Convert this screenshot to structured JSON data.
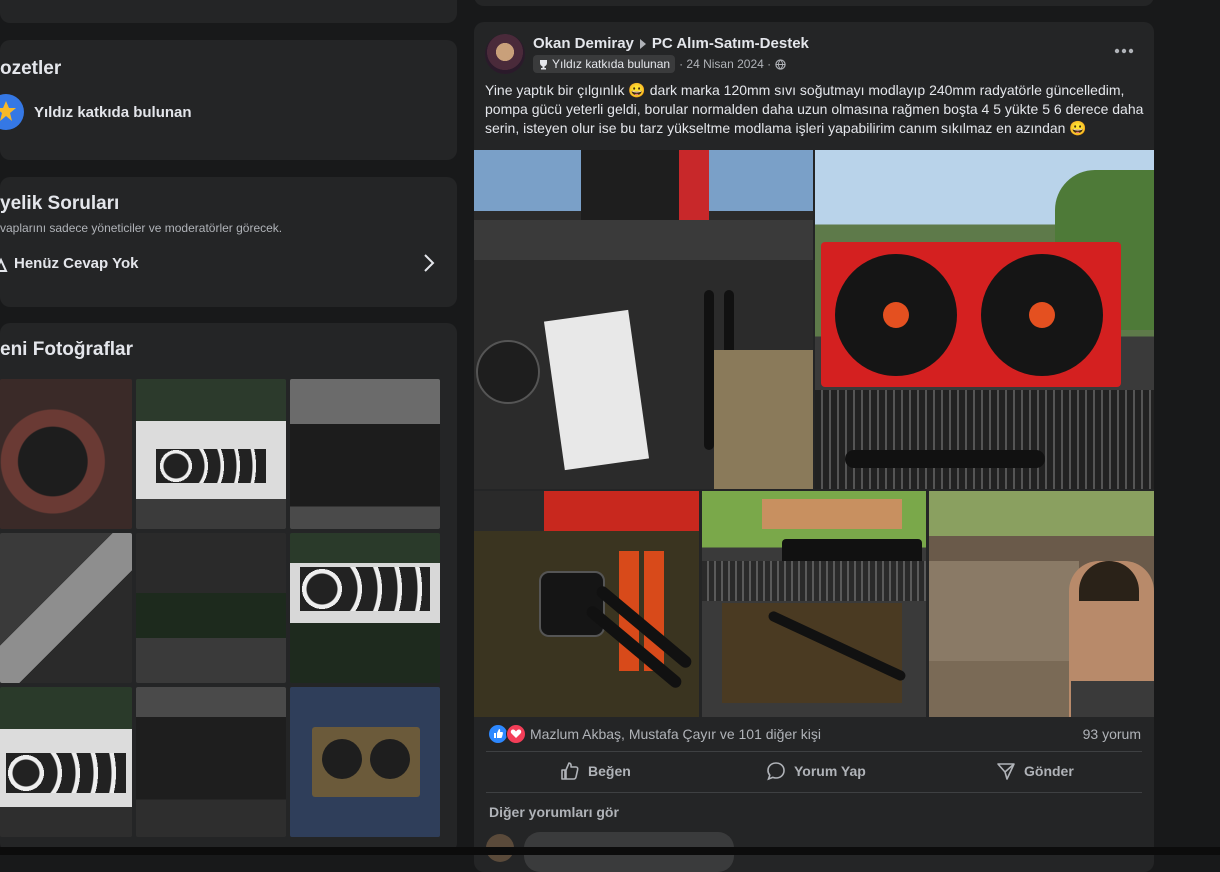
{
  "sidebar": {
    "badges": {
      "title": "ozetler",
      "item_label": "Yıldız katkıda bulunan"
    },
    "questions": {
      "title": "yelik Soruları",
      "subtitle": "vaplarını sadece yöneticiler ve moderatörler görecek.",
      "item_label": "Henüz Cevap Yok"
    },
    "photos": {
      "title": "eni Fotoğraflar"
    }
  },
  "post": {
    "author": "Okan Demiray",
    "group": "PC Alım-Satım-Destek",
    "badge": "Yıldız katkıda bulunan",
    "date": "· 24 Nisan 2024 ·",
    "text": "Yine yaptık bir çılgınlık 😀 dark marka 120mm sıvı soğutmayı modlayıp 240mm radyatörle güncelledim, pompa gücü yeterli geldi, borular normalden daha uzun olmasına rağmen boşta 4 5 yükte 5 6 derece daha serin, isteyen olur ise bu tarz yükseltme modlama işleri yapabilirim canım sıkılmaz en azından 😀",
    "reactions_text": "Mazlum Akbaş, Mustafa Çayır ve 101 diğer kişi",
    "comments_count": "93 yorum",
    "actions": {
      "like": "Beğen",
      "comment": "Yorum Yap",
      "share": "Gönder"
    },
    "more_comments": "Diğer yorumları gör"
  },
  "colors": {
    "background": "#18191a",
    "card": "#242526",
    "accent_blue": "#2d88ff",
    "reaction_red": "#f33e58"
  }
}
